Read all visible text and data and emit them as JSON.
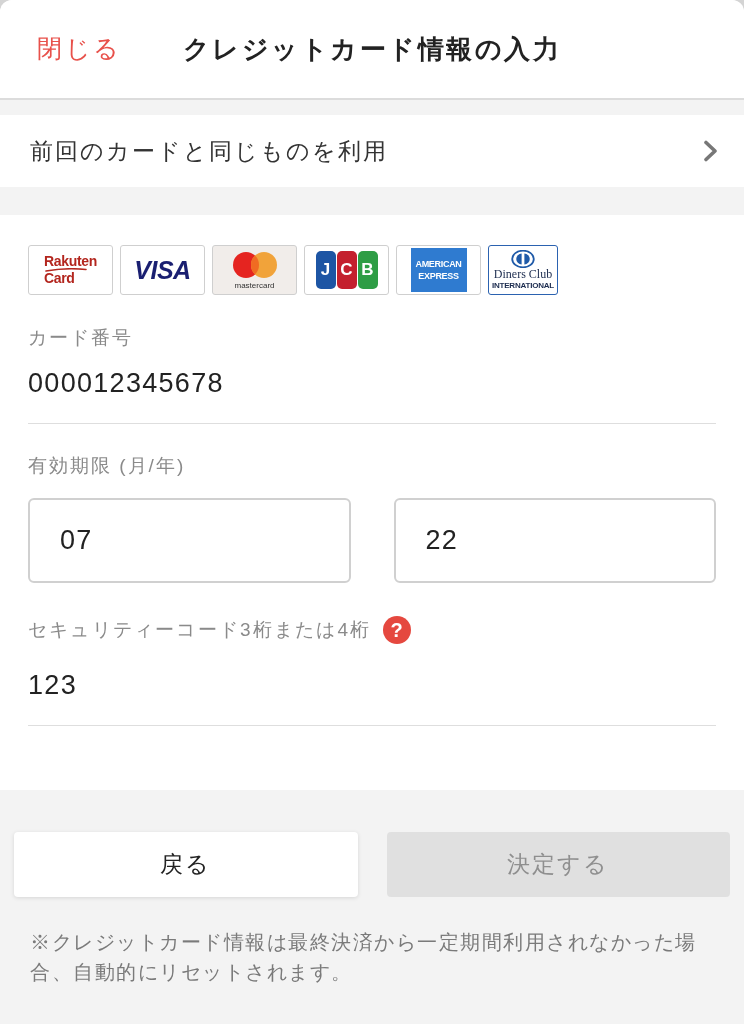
{
  "header": {
    "close_link": "閉じる",
    "title": "クレジットカード情報の入力"
  },
  "previous_card": {
    "label": "前回のカードと同じものを利用"
  },
  "card_brands": [
    {
      "kind": "rakuten",
      "texts": [
        "Rakuten",
        "Card"
      ]
    },
    {
      "kind": "visa",
      "texts": [
        "VISA"
      ]
    },
    {
      "kind": "mastercard",
      "texts": [
        "mastercard"
      ]
    },
    {
      "kind": "jcb",
      "texts": [
        "J",
        "C",
        "B"
      ]
    },
    {
      "kind": "amex",
      "texts": [
        "AMERICAN",
        "EXPRESS"
      ]
    },
    {
      "kind": "diners",
      "texts": [
        "Diners Club",
        "INTERNATIONAL"
      ]
    }
  ],
  "card_number": {
    "label": "カード番号",
    "value": "000012345678"
  },
  "expiry": {
    "label": "有効期限 (月/年)",
    "month": "07",
    "year": "22"
  },
  "security_code": {
    "label": "セキュリティーコード3桁または4桁",
    "help": "?",
    "value": "123"
  },
  "buttons": [
    {
      "label": "戻る",
      "disabled": false
    },
    {
      "label": "決定する",
      "disabled": true
    }
  ],
  "note": "※クレジットカード情報は最終決済から一定期間利用されなかった場合、自動的にリセットされます。"
}
